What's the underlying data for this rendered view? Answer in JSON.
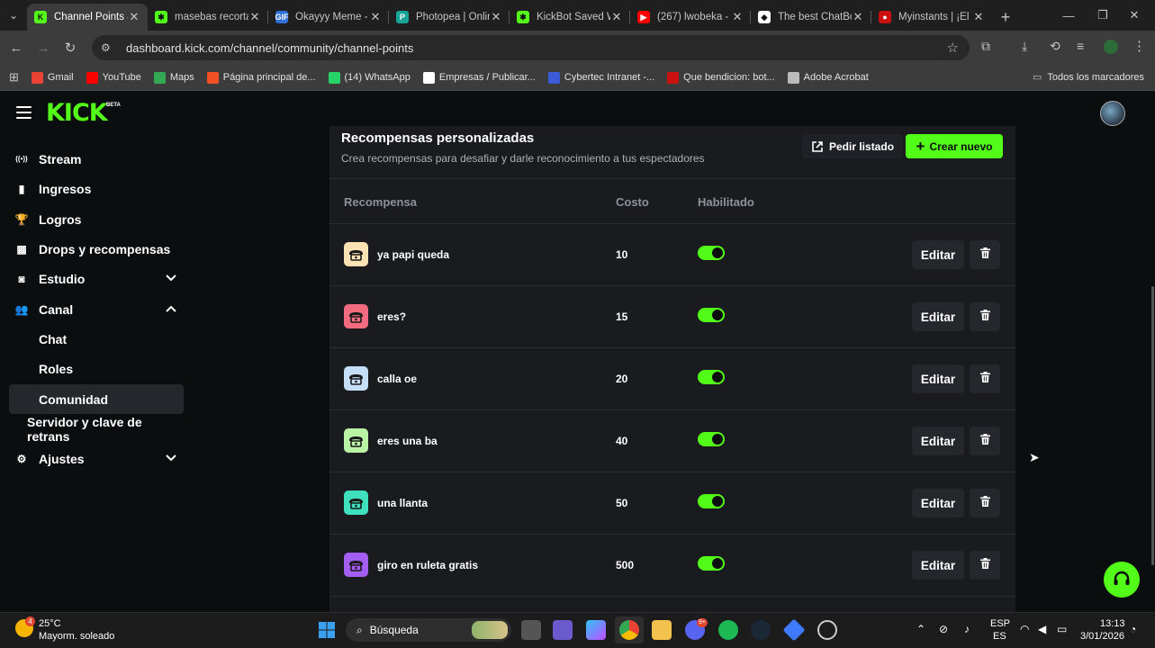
{
  "browser": {
    "tabs": [
      {
        "title": "Channel Points -",
        "color": "#53fc18",
        "glyph": "K",
        "active": true
      },
      {
        "title": "masebas recorta",
        "color": "#53fc18",
        "glyph": "✱",
        "active": false
      },
      {
        "title": "Okayyy Meme -",
        "color": "#2f6fd6",
        "glyph": "GIF",
        "active": false
      },
      {
        "title": "Photopea | Onlin",
        "color": "#18a497",
        "glyph": "P",
        "active": false
      },
      {
        "title": "KickBot Saved W",
        "color": "#53fc18",
        "glyph": "✱",
        "active": false
      },
      {
        "title": "(267) lwobeka -",
        "color": "#ff0000",
        "glyph": "▶",
        "active": false
      },
      {
        "title": "The best ChatBo",
        "color": "#ffffff",
        "glyph": "◆",
        "active": false
      },
      {
        "title": "Myinstants | ¡El s",
        "color": "#cc1010",
        "glyph": "●",
        "active": false
      }
    ],
    "url": "dashboard.kick.com/channel/community/channel-points",
    "bookmarks": [
      {
        "label": "Gmail",
        "color": "#ea4335"
      },
      {
        "label": "YouTube",
        "color": "#ff0000"
      },
      {
        "label": "Maps",
        "color": "#34a853"
      },
      {
        "label": "Página principal de...",
        "color": "#f25022"
      },
      {
        "label": "(14) WhatsApp",
        "color": "#25d366"
      },
      {
        "label": "Empresas / Publicar...",
        "color": "#ffffff"
      },
      {
        "label": "Cybertec Intranet -...",
        "color": "#3b5bdb"
      },
      {
        "label": "Que bendicion: bot...",
        "color": "#cc1010"
      },
      {
        "label": "Adobe Acrobat",
        "color": "#bbbbbb"
      }
    ],
    "all_bookmarks": "Todos los marcadores"
  },
  "kick": {
    "logo": "KICK",
    "beta": "BETA"
  },
  "sidebar": {
    "items": [
      {
        "label": "Stream",
        "icon": "broadcast-icon"
      },
      {
        "label": "Ingresos",
        "icon": "chart-icon"
      },
      {
        "label": "Logros",
        "icon": "trophy-icon"
      },
      {
        "label": "Drops y recompensas",
        "icon": "gift-icon"
      },
      {
        "label": "Estudio",
        "icon": "studio-icon"
      },
      {
        "label": "Canal",
        "icon": "users-icon"
      },
      {
        "label": "Chat"
      },
      {
        "label": "Roles"
      },
      {
        "label": "Comunidad"
      },
      {
        "label": "Servidor y clave de retrans"
      },
      {
        "label": "Ajustes",
        "icon": "gear-icon"
      }
    ]
  },
  "main": {
    "title": "Recompensas personalizadas",
    "subtitle": "Crea recompensas para desafiar y darle reconocimiento a tus espectadores",
    "request_list_label": "Pedir listado",
    "create_new_label": "Crear nuevo",
    "columns": {
      "reward": "Recompensa",
      "cost": "Costo",
      "enabled": "Habilitado"
    },
    "edit_label": "Editar",
    "rewards": [
      {
        "name": "ya papi queda",
        "cost": "10",
        "enabled": true,
        "color": "#fde3b4"
      },
      {
        "name": "eres?",
        "cost": "15",
        "enabled": true,
        "color": "#f26b7f"
      },
      {
        "name": "calla oe",
        "cost": "20",
        "enabled": true,
        "color": "#c5dff8"
      },
      {
        "name": "eres una ba",
        "cost": "40",
        "enabled": true,
        "color": "#b9f3a6"
      },
      {
        "name": "una llanta",
        "cost": "50",
        "enabled": true,
        "color": "#3ee0bd"
      },
      {
        "name": "giro en ruleta gratis",
        "cost": "500",
        "enabled": true,
        "color": "#a55ef2"
      }
    ]
  },
  "taskbar": {
    "weather_temp": "25°C",
    "weather_desc": "Mayorm. soleado",
    "search_placeholder": "Búsqueda",
    "lang": "ESP",
    "lang2": "ES",
    "time": "13:13",
    "date": "3/01/2026",
    "weather_badge": "4",
    "discord_badge": "9+"
  }
}
